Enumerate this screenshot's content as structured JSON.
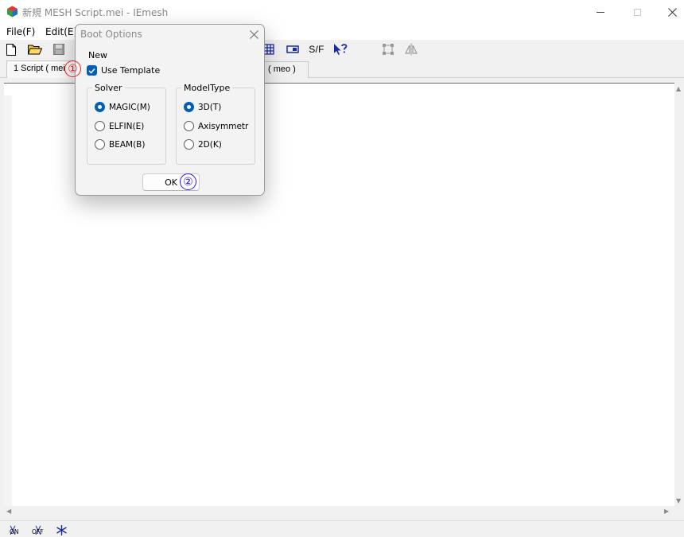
{
  "window": {
    "title": "新規 MESH Script.mei - IEmesh"
  },
  "menu": {
    "items": [
      "File(F)",
      "Edit(E)"
    ]
  },
  "toolbar": {
    "sf_label": "S/F",
    "icons": [
      "new-file-icon",
      "open-folder-icon",
      "save-icon",
      "grid-icon",
      "component-icon",
      "context-help-icon",
      "node-select-icon",
      "mirror-icon"
    ]
  },
  "tabs": [
    {
      "label": "1 Script ( mei",
      "active": true
    },
    {
      "label": "( meo )",
      "active": false
    }
  ],
  "dialog": {
    "title": "Boot Options",
    "section_label": "New",
    "use_template": {
      "label": "Use Template",
      "checked": true
    },
    "solver": {
      "label": "Solver",
      "options": [
        "MAGIC(M)",
        "ELFIN(E)",
        "BEAM(B)"
      ],
      "selected": "MAGIC(M)"
    },
    "model_type": {
      "label": "ModelType",
      "options": [
        "3D(T)",
        "Axisymmetr",
        "2D(K)"
      ],
      "selected": "3D(T)"
    },
    "ok_label": "OK"
  },
  "annotations": [
    "①",
    "②"
  ],
  "statusbar": {
    "icons": [
      "on-toggle-icon",
      "off-toggle-icon",
      "asterisk-icon"
    ]
  },
  "colors": {
    "accent": "#005fb8",
    "annotation_red": "#e02020",
    "annotation_blue": "#2a1ad8",
    "toolbar_icon_blue": "#1a2aa8"
  }
}
